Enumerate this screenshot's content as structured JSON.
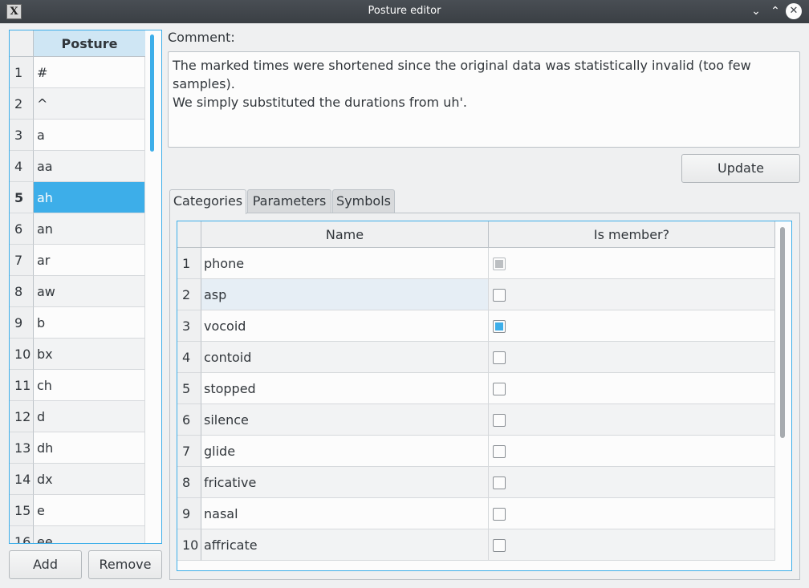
{
  "window": {
    "title": "Posture editor",
    "icon_glyph": "X",
    "min_glyph": "⌄",
    "max_glyph": "⌃",
    "close_glyph": "✕"
  },
  "posture_table": {
    "header": "Posture",
    "rows": [
      {
        "n": "1",
        "v": "#"
      },
      {
        "n": "2",
        "v": "^"
      },
      {
        "n": "3",
        "v": "a"
      },
      {
        "n": "4",
        "v": "aa"
      },
      {
        "n": "5",
        "v": "ah"
      },
      {
        "n": "6",
        "v": "an"
      },
      {
        "n": "7",
        "v": "ar"
      },
      {
        "n": "8",
        "v": "aw"
      },
      {
        "n": "9",
        "v": "b"
      },
      {
        "n": "10",
        "v": "bx"
      },
      {
        "n": "11",
        "v": "ch"
      },
      {
        "n": "12",
        "v": "d"
      },
      {
        "n": "13",
        "v": "dh"
      },
      {
        "n": "14",
        "v": "dx"
      },
      {
        "n": "15",
        "v": "e"
      },
      {
        "n": "16",
        "v": "ee"
      }
    ],
    "selected_row": "5"
  },
  "buttons": {
    "add": "Add",
    "remove": "Remove",
    "update": "Update"
  },
  "comment": {
    "label": "Comment:",
    "text": "The marked times were shortened since the original data was statistically invalid (too few samples).\nWe simply substituted the durations from uh'."
  },
  "tabs": {
    "categories": "Categories",
    "parameters": "Parameters",
    "symbols": "Symbols",
    "active": "Categories"
  },
  "categories_table": {
    "headers": {
      "name": "Name",
      "member": "Is member?"
    },
    "rows": [
      {
        "n": "1",
        "name": "phone",
        "member": true,
        "disabled": true
      },
      {
        "n": "2",
        "name": "asp",
        "member": false
      },
      {
        "n": "3",
        "name": "vocoid",
        "member": true
      },
      {
        "n": "4",
        "name": "contoid",
        "member": false
      },
      {
        "n": "5",
        "name": "stopped",
        "member": false
      },
      {
        "n": "6",
        "name": "silence",
        "member": false
      },
      {
        "n": "7",
        "name": "glide",
        "member": false
      },
      {
        "n": "8",
        "name": "fricative",
        "member": false
      },
      {
        "n": "9",
        "name": "nasal",
        "member": false
      },
      {
        "n": "10",
        "name": "affricate",
        "member": false
      }
    ]
  },
  "colors": {
    "accent": "#3daee9",
    "window_bg": "#eff0f1",
    "titlebar": "#3d4247"
  }
}
